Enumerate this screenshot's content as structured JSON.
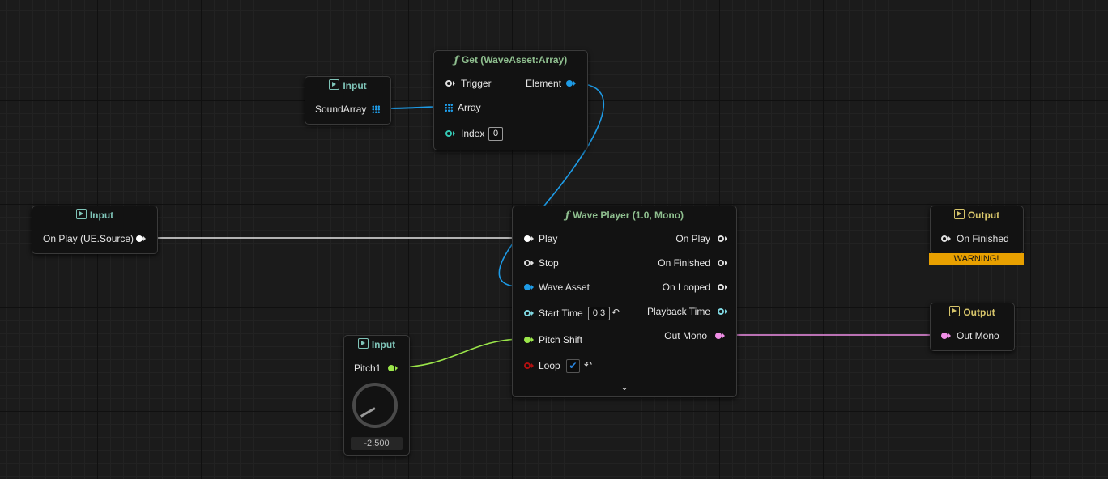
{
  "graph": {
    "nodes": {
      "input_sound_array": {
        "title": "Input",
        "outputs": [
          "SoundArray"
        ]
      },
      "get_wave_asset": {
        "title": "Get (WaveAsset:Array)",
        "inputs": [
          "Trigger",
          "Array",
          "Index"
        ],
        "index_value": "0",
        "outputs": [
          "Element"
        ]
      },
      "input_on_play": {
        "title": "Input",
        "outputs": [
          "On Play (UE.Source)"
        ]
      },
      "wave_player": {
        "title": "Wave Player (1.0, Mono)",
        "inputs": [
          "Play",
          "Stop",
          "Wave Asset",
          "Start Time",
          "Pitch Shift",
          "Loop"
        ],
        "start_time_value": "0.3",
        "loop_checked": true,
        "outputs": [
          "On Play",
          "On Finished",
          "On Looped",
          "Playback Time",
          "Out Mono"
        ]
      },
      "output_on_finished": {
        "title": "Output",
        "inputs": [
          "On Finished"
        ],
        "warning": "WARNING!"
      },
      "output_out_mono": {
        "title": "Output",
        "inputs": [
          "Out Mono"
        ]
      },
      "input_pitch": {
        "title": "Input",
        "outputs": [
          "Pitch1"
        ],
        "knob_value": "-2.500"
      }
    },
    "colors": {
      "exec": "#ffffff",
      "wave_asset": "#1e9be6",
      "float": "#9be64a",
      "audio": "#f08ee6",
      "warning": "#e8a000"
    }
  }
}
